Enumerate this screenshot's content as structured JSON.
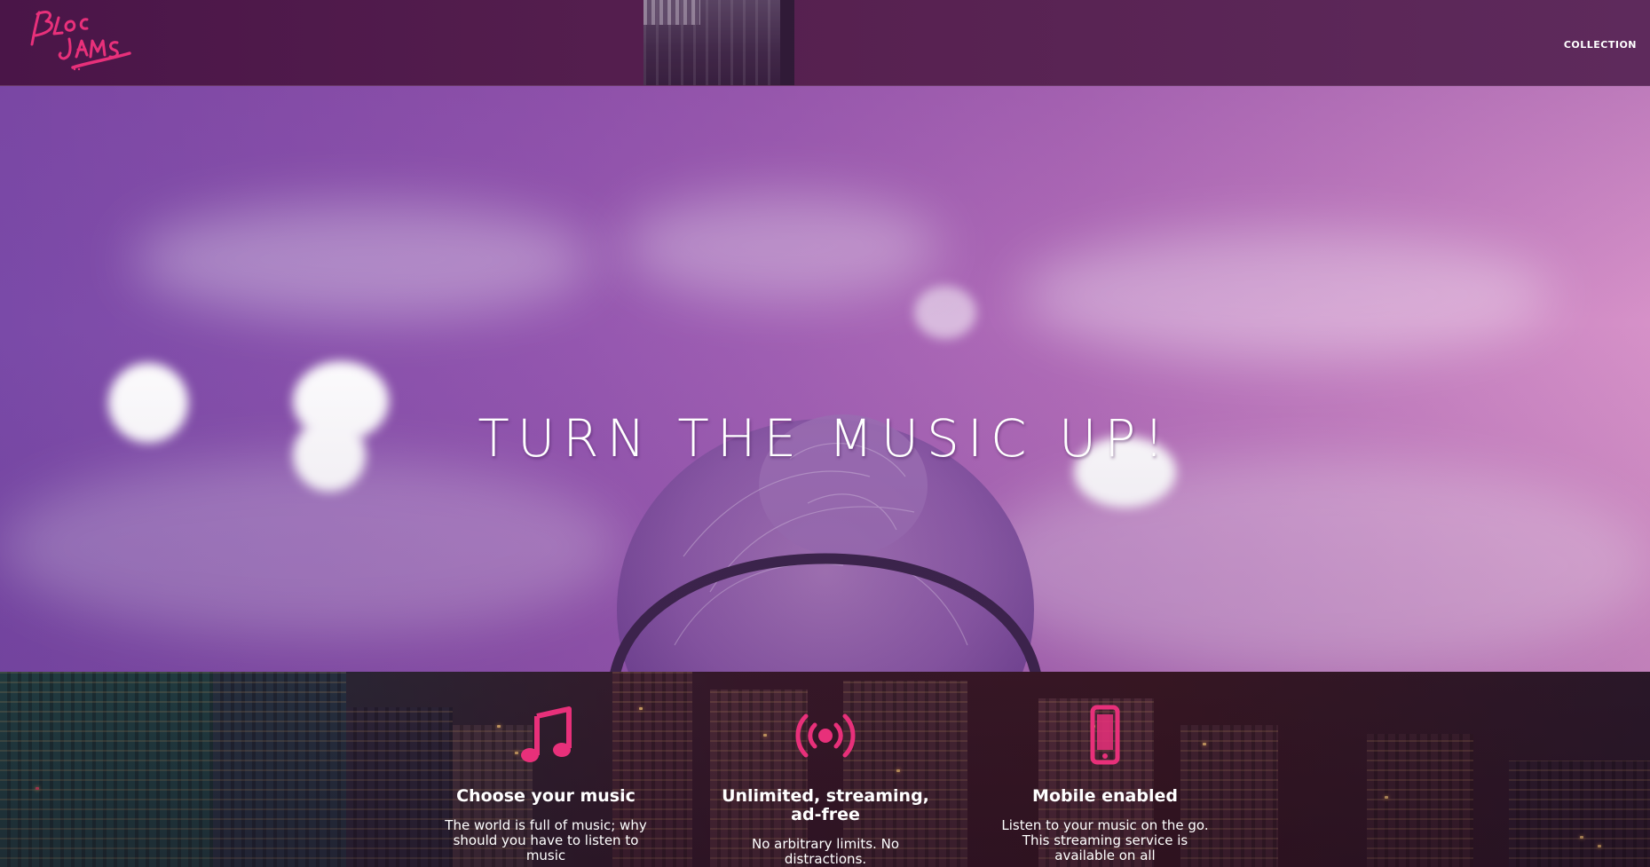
{
  "navbar": {
    "logo_text": "BLOC JAMS",
    "links": [
      {
        "label": "COLLECTION"
      }
    ]
  },
  "hero": {
    "title": "TURN THE MUSIC UP!"
  },
  "selling_points": [
    {
      "icon": "music-note-icon",
      "title": "Choose your music",
      "text": "The world is full of music; why should you have to listen to music"
    },
    {
      "icon": "broadcast-icon",
      "title": "Unlimited, streaming, ad-free",
      "text": "No arbitrary limits. No distractions."
    },
    {
      "icon": "mobile-phone-icon",
      "title": "Mobile enabled",
      "text": "Listen to your music on the go. This streaming service is available on all"
    }
  ],
  "colors": {
    "accent_pink": "#e8307a",
    "navbar_bg": "#4a1548",
    "hero_overlay": "#9557b0"
  }
}
